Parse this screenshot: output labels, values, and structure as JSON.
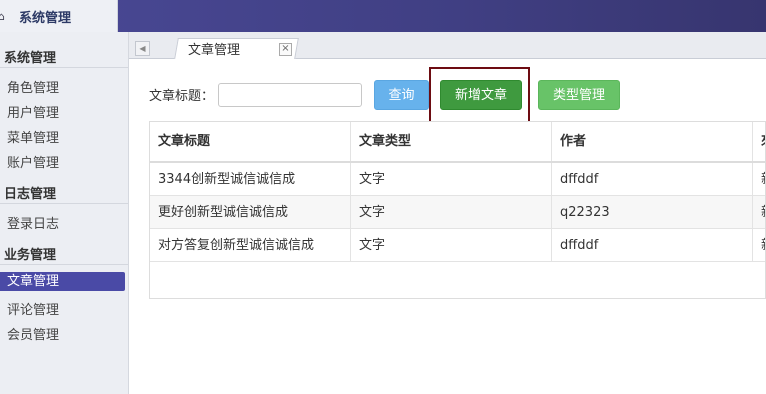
{
  "header": {
    "title": "系统管理",
    "icon": "home-icon"
  },
  "sidebar": {
    "groups": [
      {
        "title": "系统管理",
        "items": [
          "角色管理",
          "用户管理",
          "菜单管理",
          "账户管理"
        ]
      },
      {
        "title": "日志管理",
        "items": [
          "登录日志"
        ]
      },
      {
        "title": "业务管理",
        "items": [
          "文章管理",
          "评论管理",
          "会员管理"
        ]
      }
    ],
    "active_item": "文章管理",
    "active_color": "#4a4aa6"
  },
  "tabs": [
    {
      "label": "文章管理",
      "closable": true
    }
  ],
  "search": {
    "label": "文章标题：",
    "value": "",
    "placeholder": ""
  },
  "toolbar": {
    "query_label": "查询",
    "add_label": "新增文章",
    "type_label": "类型管理"
  },
  "table": {
    "columns": [
      "文章标题",
      "文章类型",
      "作者",
      "來"
    ],
    "rows": [
      [
        "3344创新型诚信诚信成",
        "文字",
        "dffddf",
        "新"
      ],
      [
        "更好创新型诚信诚信成",
        "文字",
        "q22323",
        "新"
      ],
      [
        "对方答复创新型诚信诚信成",
        "文字",
        "dffddf",
        "新"
      ]
    ]
  },
  "colors": {
    "topbar": "#403f83",
    "query_button": "#67b2ec",
    "add_button": "#3f9a3f",
    "type_button": "#68c368",
    "highlight_border": "#6d0c12"
  }
}
